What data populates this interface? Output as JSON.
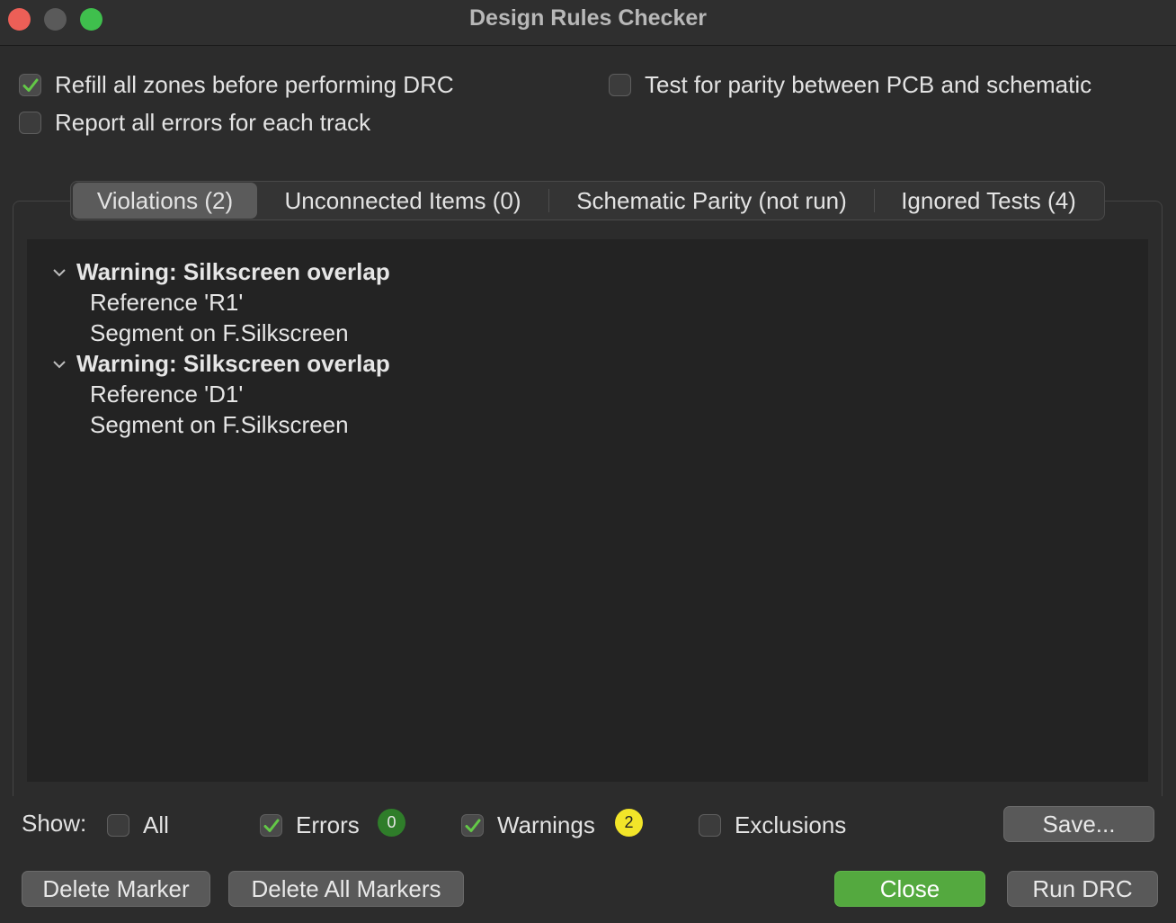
{
  "window": {
    "title": "Design Rules Checker"
  },
  "options": {
    "refill_zones": {
      "label": "Refill all zones before performing DRC",
      "checked": true
    },
    "report_all": {
      "label": "Report all errors for each track",
      "checked": false
    },
    "parity": {
      "label": "Test for parity between PCB and schematic",
      "checked": false
    }
  },
  "tabs": [
    {
      "label": "Violations (2)"
    },
    {
      "label": "Unconnected Items (0)"
    },
    {
      "label": "Schematic Parity (not run)"
    },
    {
      "label": "Ignored Tests (4)"
    }
  ],
  "violations": [
    {
      "title": "Warning: Silkscreen overlap",
      "items": [
        "Reference 'R1'",
        "Segment on F.Silkscreen"
      ]
    },
    {
      "title": "Warning: Silkscreen overlap",
      "items": [
        "Reference 'D1'",
        "Segment on F.Silkscreen"
      ]
    }
  ],
  "filters": {
    "show_label": "Show:",
    "all": {
      "label": "All",
      "checked": false
    },
    "errors": {
      "label": "Errors",
      "checked": true,
      "count": "0",
      "badge_color": "#2f7d2a"
    },
    "warnings": {
      "label": "Warnings",
      "checked": true,
      "count": "2",
      "badge_color": "#f2e529"
    },
    "exclusions": {
      "label": "Exclusions",
      "checked": false
    }
  },
  "buttons": {
    "save": "Save...",
    "delete_marker": "Delete Marker",
    "delete_all_markers": "Delete All Markers",
    "close": "Close",
    "run_drc": "Run DRC"
  },
  "colors": {
    "accent_green": "#54a93f",
    "check_green": "#63c847"
  }
}
